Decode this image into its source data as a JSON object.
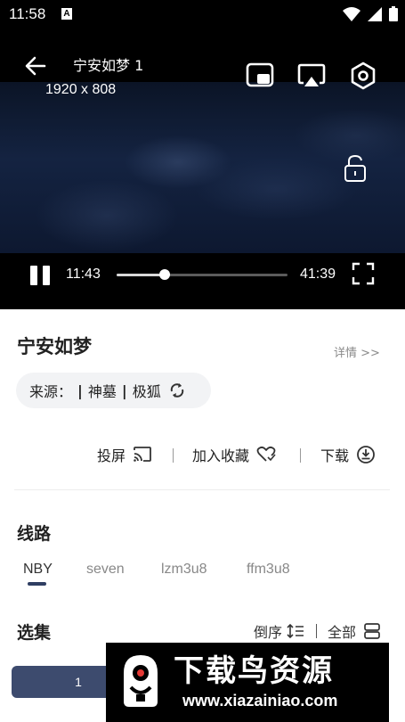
{
  "status_bar": {
    "time": "11:58",
    "notification_badge": "A",
    "icons": [
      "wifi-icon",
      "signal-icon",
      "battery-icon"
    ]
  },
  "player": {
    "title": "宁安如梦 1",
    "resolution": "1920 x 808",
    "current_time": "11:43",
    "total_time": "41:39",
    "progress_fraction": 0.28,
    "top_icons": [
      "picture-in-picture-icon",
      "cast-screen-icon",
      "settings-icon"
    ]
  },
  "show": {
    "title": "宁安如梦",
    "details_link": "详情 >>",
    "source_label": "来源：",
    "sources": [
      "神墓",
      "极狐"
    ]
  },
  "actions": {
    "cast": "投屏",
    "favorite": "加入收藏",
    "download": "下载"
  },
  "routes": {
    "title": "线路",
    "items": [
      "NBY",
      "seven",
      "lzm3u8",
      "ffm3u8"
    ],
    "active_index": 0
  },
  "episodes": {
    "title": "选集",
    "sort_label": "倒序",
    "all_label": "全部",
    "items": [
      "1"
    ]
  },
  "watermark": {
    "title": "下载鸟资源",
    "url": "www.xiazainiao.com"
  },
  "colors": {
    "accent": "#3d4b6e",
    "underline": "#2f3e62",
    "pill_bg": "#f2f3f5"
  }
}
